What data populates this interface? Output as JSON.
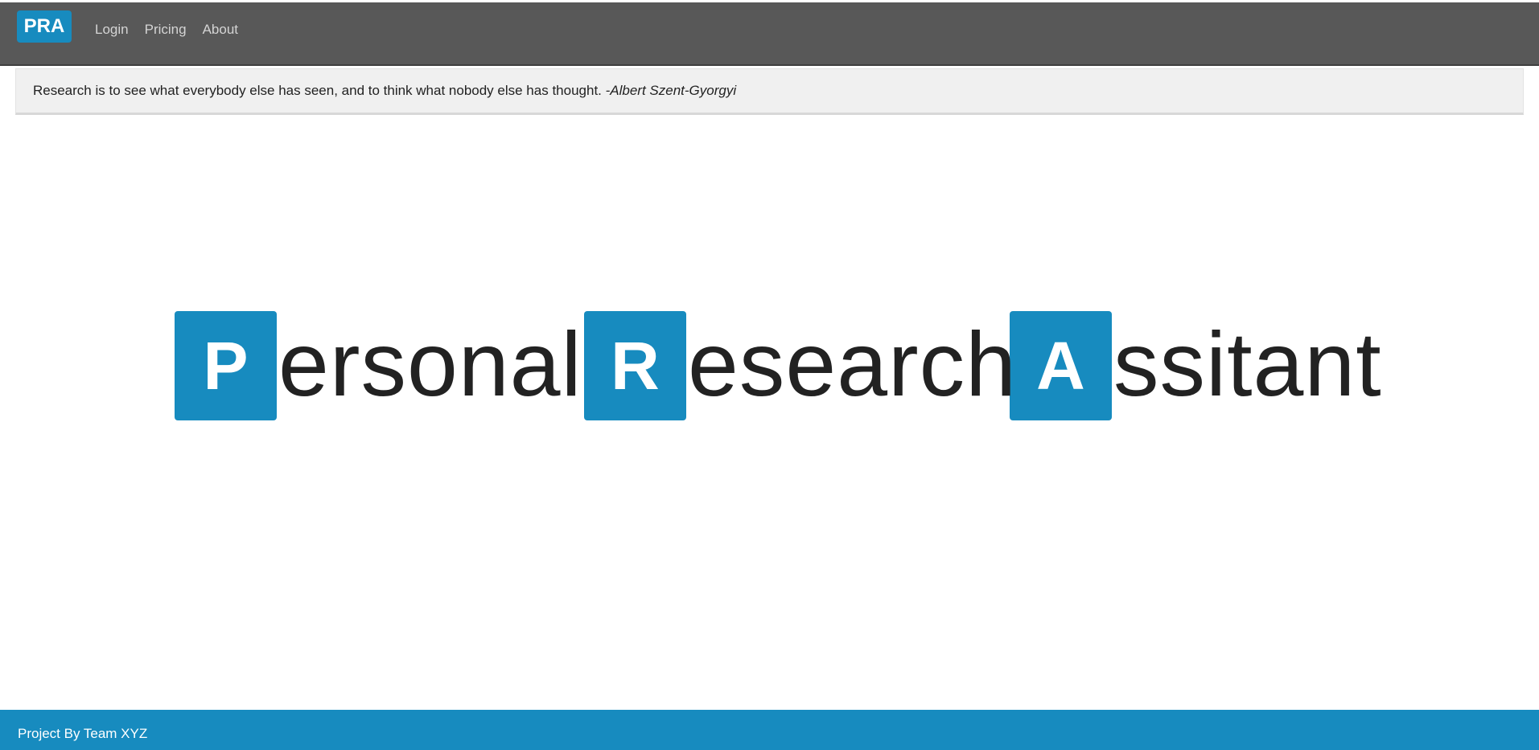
{
  "navbar": {
    "brand": "PRA",
    "links": [
      "Login",
      "Pricing",
      "About"
    ]
  },
  "quote": {
    "text": "Research is to see what everybody else has seen, and to think what nobody else has thought. ",
    "author": "-Albert Szent-Gyorgyi"
  },
  "hero": {
    "words": [
      {
        "initial": "P",
        "rest": "ersonal"
      },
      {
        "initial": "R",
        "rest": "esearch"
      },
      {
        "initial": "A",
        "rest": "ssitant"
      }
    ]
  },
  "footer": {
    "text": "Project By Team XYZ"
  },
  "colors": {
    "accent": "#178bbf",
    "navbar": "#585858",
    "quote_bg": "#f0f0f0"
  }
}
